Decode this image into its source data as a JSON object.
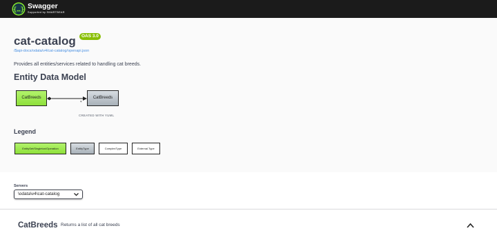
{
  "topbar": {
    "brand": "Swagger",
    "tagline": "Supported by SMARTBEAR",
    "logo_icon": "swagger-logo-icon",
    "background": "#1b1b1b",
    "logo_color": "#85ea2d"
  },
  "info": {
    "title": "cat-catalog",
    "version_badge": "OAS 3.0",
    "spec_url": "/$api-docs/odata/v4/cat-catalog/openapi.json",
    "description": "Provides all entities/services related to handling cat breeds.",
    "badge_color": "#89bf04",
    "link_color": "#4990e2"
  },
  "entity_model": {
    "heading": "Entity Data Model",
    "diagram": {
      "source": "CatBreeds",
      "target": "CatBreeds",
      "multiplicity": "*",
      "footer": "CREATED WITH YUML"
    }
  },
  "legend": {
    "heading": "Legend",
    "items": [
      "EntitySet/Singleton/Operation",
      "EntityType",
      "ComplexType",
      "External.Type"
    ],
    "colors": [
      "#8ee03a",
      "#a7b0b8",
      "#ffffff",
      "#ffffff"
    ]
  },
  "servers": {
    "label": "Servers",
    "selected": "\\odata\\v4\\cat-catalog"
  },
  "tag": {
    "name": "CatBreeds",
    "description": "Returns a list of all cat breeds",
    "toggle_icon": "chevron-up-icon"
  }
}
